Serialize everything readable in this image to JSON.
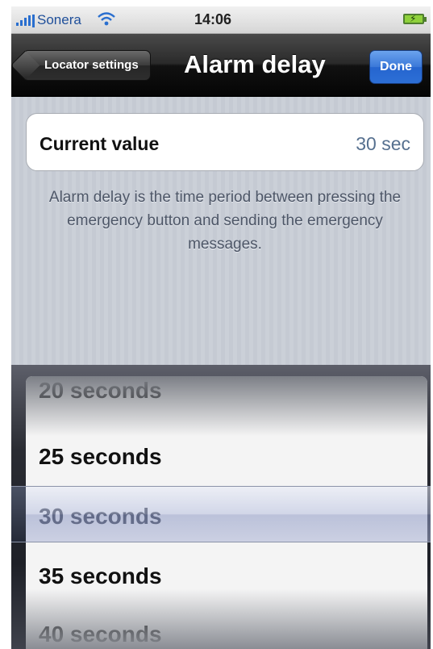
{
  "status_bar": {
    "carrier": "Sonera",
    "time": "14:06",
    "signal_icon": "signal-bars-icon",
    "wifi_icon": "wifi-icon",
    "battery_icon": "battery-charging-icon"
  },
  "nav": {
    "back_label": "Locator settings",
    "title": "Alarm delay",
    "done_label": "Done"
  },
  "current_value": {
    "label": "Current value",
    "value": "30 sec"
  },
  "description": "Alarm delay is the time period between pressing the emergency button and sending the emergency messages.",
  "picker": {
    "options": [
      "20 seconds",
      "25 seconds",
      "30 seconds",
      "35 seconds",
      "40 seconds"
    ],
    "selected": "30 seconds"
  },
  "colors": {
    "done_button": "#2d6fd6",
    "value_text": "#56708f"
  }
}
